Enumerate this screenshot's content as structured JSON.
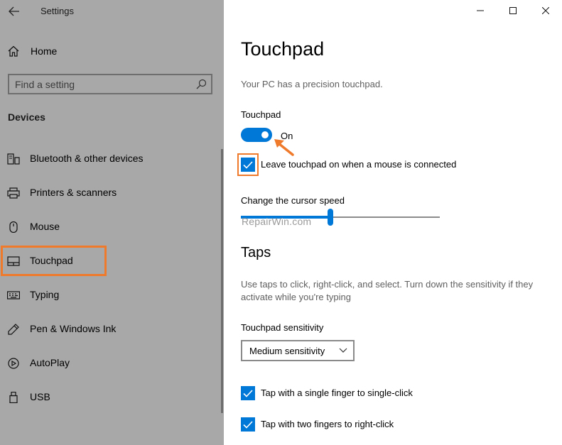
{
  "window": {
    "title": "Settings"
  },
  "sidebar": {
    "home_label": "Home",
    "search_placeholder": "Find a setting",
    "section": "Devices",
    "items": [
      {
        "label": "Bluetooth & other devices",
        "icon": "bluetooth-devices-icon"
      },
      {
        "label": "Printers & scanners",
        "icon": "printer-icon"
      },
      {
        "label": "Mouse",
        "icon": "mouse-icon"
      },
      {
        "label": "Touchpad",
        "icon": "touchpad-icon",
        "selected": true
      },
      {
        "label": "Typing",
        "icon": "keyboard-icon"
      },
      {
        "label": "Pen & Windows Ink",
        "icon": "pen-icon"
      },
      {
        "label": "AutoPlay",
        "icon": "autoplay-icon"
      },
      {
        "label": "USB",
        "icon": "usb-icon"
      }
    ]
  },
  "main": {
    "title": "Touchpad",
    "subtitle": "Your PC has a precision touchpad.",
    "toggle": {
      "label": "Touchpad",
      "state": "On",
      "on": true
    },
    "leave_on_checkbox": {
      "label": "Leave touchpad on when a mouse is connected",
      "checked": true
    },
    "cursor_speed": {
      "label": "Change the cursor speed",
      "value_fraction": 0.45
    },
    "watermark": "RepairWin.com",
    "taps": {
      "heading": "Taps",
      "description": "Use taps to click, right-click, and select. Turn down the sensitivity if they activate while you're typing",
      "sensitivity_label": "Touchpad sensitivity",
      "sensitivity_value": "Medium sensitivity",
      "options": [
        {
          "label": "Tap with a single finger to single-click",
          "checked": true
        },
        {
          "label": "Tap with two fingers to right-click",
          "checked": true
        }
      ]
    }
  },
  "colors": {
    "accent": "#0078d7",
    "highlight": "#ef7a2b",
    "sidebar_bg": "#a8a8a8"
  }
}
